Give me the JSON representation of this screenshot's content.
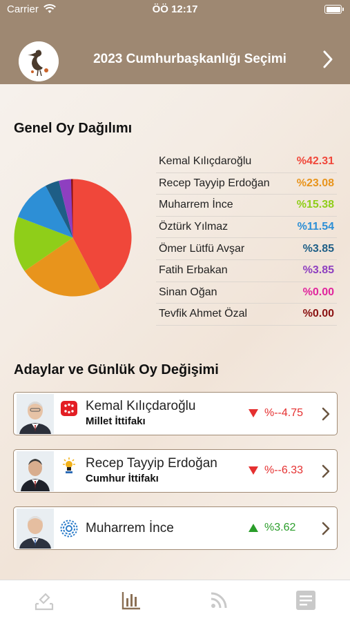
{
  "status_bar": {
    "carrier": "Carrier",
    "time": "ÖÖ 12:17"
  },
  "header": {
    "title": "2023 Cumhurbaşkanlığı Seçimi",
    "logo_icon": "heron-logo-icon",
    "next_icon": "chevron-right-icon"
  },
  "section_distribution": {
    "title": "Genel Oy Dağılımı"
  },
  "section_candidates": {
    "title": "Adaylar ve Günlük Oy Değişimi"
  },
  "chart_data": {
    "type": "pie",
    "title": "",
    "slices": [
      {
        "label": "Kemal Kılıçdaroğlu",
        "value_text": "%42.31",
        "value": 42.31,
        "color": "#f0473a"
      },
      {
        "label": "Recep Tayyip Erdoğan",
        "value_text": "%23.08",
        "value": 23.08,
        "color": "#e8941c"
      },
      {
        "label": "Muharrem İnce",
        "value_text": "%15.38",
        "value": 15.38,
        "color": "#8fce19"
      },
      {
        "label": "Öztürk Yılmaz",
        "value_text": "%11.54",
        "value": 11.54,
        "color": "#2d8fd6"
      },
      {
        "label": "Ömer Lütfü Avşar",
        "value_text": "%3.85",
        "value": 3.85,
        "color": "#1e5e86"
      },
      {
        "label": "Fatih Erbakan",
        "value_text": "%3.85",
        "value": 3.85,
        "color": "#8e3fc0"
      },
      {
        "label": "Sinan Oğan",
        "value_text": "%0.00",
        "value": 0.0,
        "color": "#e0259d"
      },
      {
        "label": "Tevfik Ahmet Özal",
        "value_text": "%0.00",
        "value": 0.0,
        "color": "#8a1111"
      }
    ],
    "legend": "right"
  },
  "candidates": [
    {
      "name": "Kemal Kılıçdaroğlu",
      "alliance": "Millet İttifakı",
      "change": "%--4.75",
      "direction": "down",
      "party_icon": "chp-logo-icon"
    },
    {
      "name": "Recep Tayyip Erdoğan",
      "alliance": "Cumhur İttifakı",
      "change": "%--6.33",
      "direction": "up-missing",
      "party_icon": "akp-logo-icon"
    },
    {
      "name": "Muharrem İnce",
      "alliance": "",
      "change": "%3.62",
      "direction": "up",
      "party_icon": "memleket-logo-icon"
    }
  ],
  "tabs": [
    {
      "name": "vote-tab",
      "icon": "ballot-icon",
      "active": false
    },
    {
      "name": "stats-tab",
      "icon": "bar-chart-icon",
      "active": true
    },
    {
      "name": "feed-tab",
      "icon": "rss-icon",
      "active": false
    },
    {
      "name": "news-tab",
      "icon": "document-icon",
      "active": false
    }
  ],
  "colors": {
    "header": "#9e8872",
    "active_tab": "#8b7055",
    "inactive_tab": "#c9c9c9",
    "down": "#e53030",
    "up": "#2a9d2a"
  }
}
